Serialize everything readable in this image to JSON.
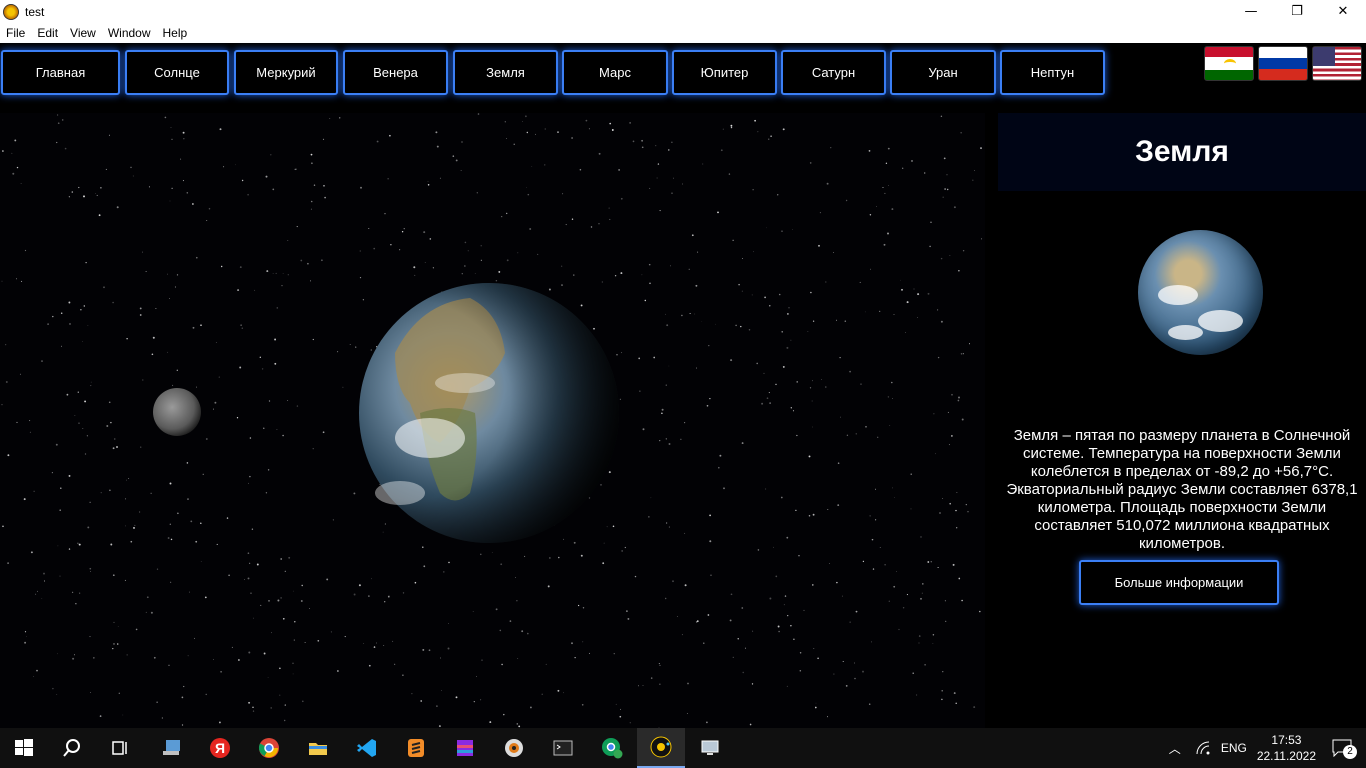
{
  "window": {
    "title": "test",
    "minimize": "—",
    "maximize": "❐",
    "close": "✕"
  },
  "menu": [
    "File",
    "Edit",
    "View",
    "Window",
    "Help"
  ],
  "nav": [
    "Главная",
    "Солнце",
    "Меркурий",
    "Венера",
    "Земля",
    "Марс",
    "Юпитер",
    "Сатурн",
    "Уран",
    "Нептун"
  ],
  "flags": [
    {
      "name": "flag-tajikistan-icon"
    },
    {
      "name": "flag-russia-icon"
    },
    {
      "name": "flag-usa-icon"
    }
  ],
  "panel": {
    "title": "Земля",
    "description": "Земля – пятая по размеру планета в Солнечной системе. Температура на поверхности Земли колеблется в пределах от -89,2 до +56,7°C. Экваториальный радиус Земли составляет 6378,1 километра. Площадь поверхности Земли составляет 510,072 миллиона квадратных километров.",
    "more_button": "Больше информации"
  },
  "taskbar": {
    "apps": [
      "start-icon",
      "search-icon",
      "task-view-icon",
      "computer-icon",
      "yandex-browser-icon",
      "chrome-icon",
      "file-explorer-icon",
      "vscode-icon",
      "sublime-text-icon",
      "winrar-icon",
      "media-player-icon",
      "terminal-icon",
      "chrome-profile-icon",
      "solar-system-app-icon",
      "remote-desktop-icon"
    ],
    "yandex_glyph": "Я",
    "language": "ENG",
    "time": "17:53",
    "date": "22.11.2022",
    "notifications": "2"
  }
}
